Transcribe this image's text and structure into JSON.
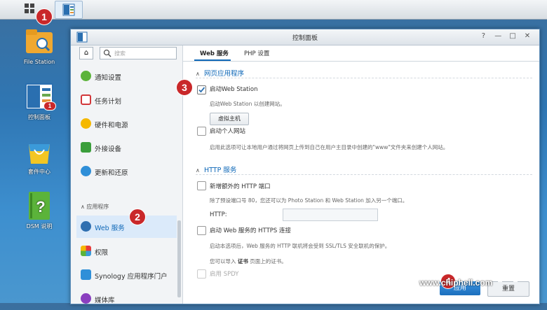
{
  "window": {
    "title": "控制面板",
    "controls": [
      "?",
      "—",
      "□",
      "✕"
    ]
  },
  "desktop": {
    "icons": [
      {
        "label": "File Station"
      },
      {
        "label": "控制面板",
        "badge": "1"
      },
      {
        "label": "套件中心"
      },
      {
        "label": "DSM 说明"
      }
    ]
  },
  "sidebar": {
    "search_placeholder": "搜索",
    "items": [
      {
        "label": "通知设置"
      },
      {
        "label": "任务计划"
      },
      {
        "label": "硬件和电源"
      },
      {
        "label": "外接设备"
      },
      {
        "label": "更新和还原"
      },
      {
        "label": "Web 服务"
      },
      {
        "label": "权限"
      },
      {
        "label": "Synology 应用程序门户"
      },
      {
        "label": "媒体库"
      }
    ],
    "section_header": "应用程序"
  },
  "tabs": [
    {
      "label": "Web 服务"
    },
    {
      "label": "PHP 设置"
    }
  ],
  "web_apps": {
    "heading": "网页应用程序",
    "enable_ws_label": "启动Web Station",
    "enable_ws_desc": "启动Web Station 以创建网站。",
    "vhost_button": "虚拟主机",
    "personal_site_label": "启动个人网站",
    "personal_site_desc": "启用此选项可让本地用户通过将网页上传到自己在用户主目录中创建的\"www\"文件夹来创建个人网站。"
  },
  "http": {
    "heading": "HTTP 服务",
    "extra_port_label": "新增额外的 HTTP 端口",
    "extra_port_desc": "除了预设端口号 80，您还可以为 Photo Station 和 Web Station 加入另一个端口。",
    "http_field_label": "HTTP:",
    "https_label": "启动 Web 服务的 HTTPS 连接",
    "https_desc": "启动本选项后，Web 服务的 HTTP 联机将会受到 SSL/TLS 安全联机的保护。",
    "cert_prefix": "您可以导入",
    "cert_link": "证书",
    "cert_suffix": "页面上的证书。",
    "spdy_label": "启用 SPDY"
  },
  "footer": {
    "apply": "应用",
    "reset": "重置"
  },
  "annotations": [
    "1",
    "2",
    "3",
    "4"
  ],
  "watermark": "www.chiphell.com",
  "colors": {
    "accent": "#0f68b8",
    "annotation": "#c9282a"
  }
}
